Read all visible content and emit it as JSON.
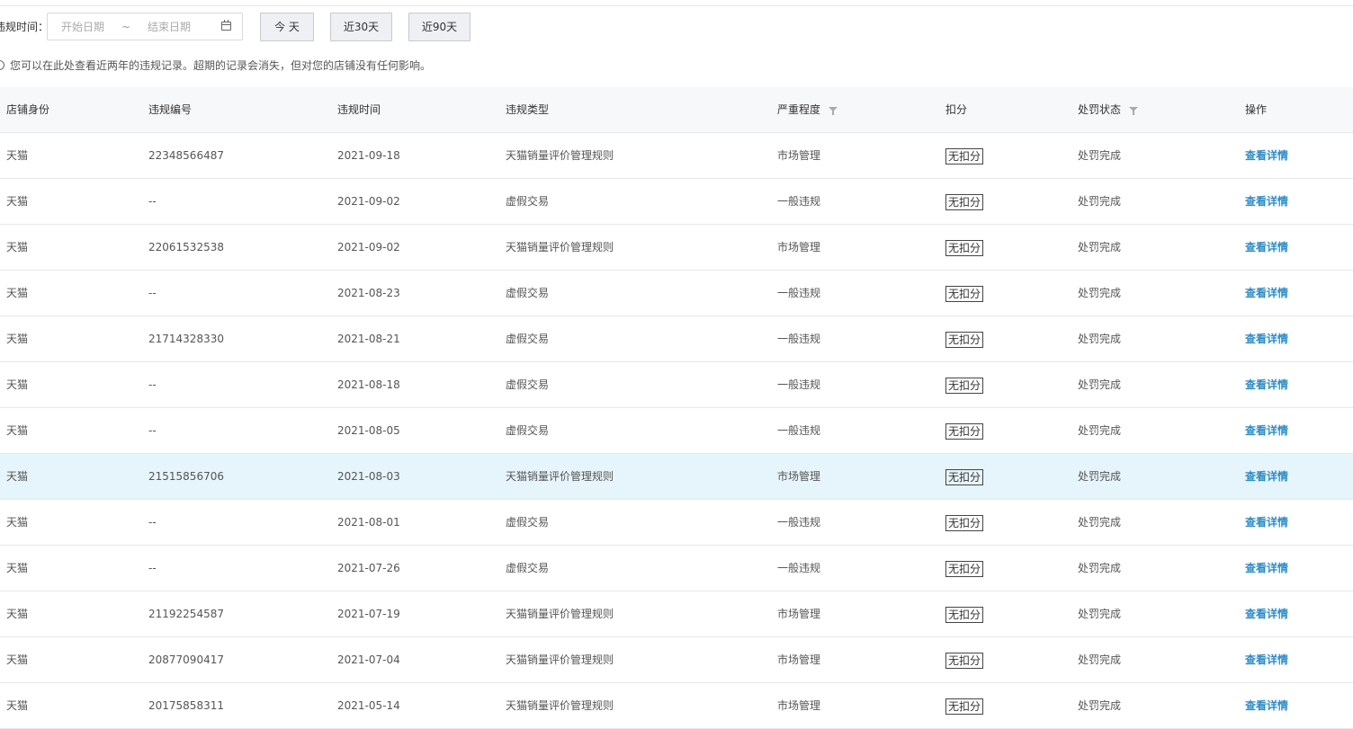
{
  "filter": {
    "label": "违规时间：",
    "start_placeholder": "开始日期",
    "separator": "~",
    "end_placeholder": "结束日期",
    "quick": {
      "today": "今 天",
      "last30": "近30天",
      "last90": "近90天"
    }
  },
  "notice": "您可以在此处查看近两年的违规记录。超期的记录会消失，但对您的店铺没有任何影响。",
  "table": {
    "headers": [
      "店铺身份",
      "违规编号",
      "违规时间",
      "违规类型",
      "严重程度",
      "扣分",
      "处罚状态",
      "操作"
    ],
    "rows": [
      [
        "天猫",
        "22348566487",
        "2021-09-18",
        "天猫销量评价管理规则",
        "市场管理",
        "无扣分",
        "处罚完成",
        "查看详情"
      ],
      [
        "天猫",
        "--",
        "2021-09-02",
        "虚假交易",
        "一般违规",
        "无扣分",
        "处罚完成",
        "查看详情"
      ],
      [
        "天猫",
        "22061532538",
        "2021-09-02",
        "天猫销量评价管理规则",
        "市场管理",
        "无扣分",
        "处罚完成",
        "查看详情"
      ],
      [
        "天猫",
        "--",
        "2021-08-23",
        "虚假交易",
        "一般违规",
        "无扣分",
        "处罚完成",
        "查看详情"
      ],
      [
        "天猫",
        "21714328330",
        "2021-08-21",
        "虚假交易",
        "一般违规",
        "无扣分",
        "处罚完成",
        "查看详情"
      ],
      [
        "天猫",
        "--",
        "2021-08-18",
        "虚假交易",
        "一般违规",
        "无扣分",
        "处罚完成",
        "查看详情"
      ],
      [
        "天猫",
        "--",
        "2021-08-05",
        "虚假交易",
        "一般违规",
        "无扣分",
        "处罚完成",
        "查看详情"
      ],
      [
        "天猫",
        "21515856706",
        "2021-08-03",
        "天猫销量评价管理规则",
        "市场管理",
        "无扣分",
        "处罚完成",
        "查看详情"
      ],
      [
        "天猫",
        "--",
        "2021-08-01",
        "虚假交易",
        "一般违规",
        "无扣分",
        "处罚完成",
        "查看详情"
      ],
      [
        "天猫",
        "--",
        "2021-07-26",
        "虚假交易",
        "一般违规",
        "无扣分",
        "处罚完成",
        "查看详情"
      ],
      [
        "天猫",
        "21192254587",
        "2021-07-19",
        "天猫销量评价管理规则",
        "市场管理",
        "无扣分",
        "处罚完成",
        "查看详情"
      ],
      [
        "天猫",
        "20877090417",
        "2021-07-04",
        "天猫销量评价管理规则",
        "市场管理",
        "无扣分",
        "处罚完成",
        "查看详情"
      ],
      [
        "天猫",
        "20175858311",
        "2021-05-14",
        "天猫销量评价管理规则",
        "市场管理",
        "无扣分",
        "处罚完成",
        "查看详情"
      ]
    ]
  },
  "colors": {
    "link": "#2d8cc7",
    "highlight_row": "#e6f4fb",
    "header_bg": "#f7f8fa",
    "border": "#e8e8e8"
  }
}
